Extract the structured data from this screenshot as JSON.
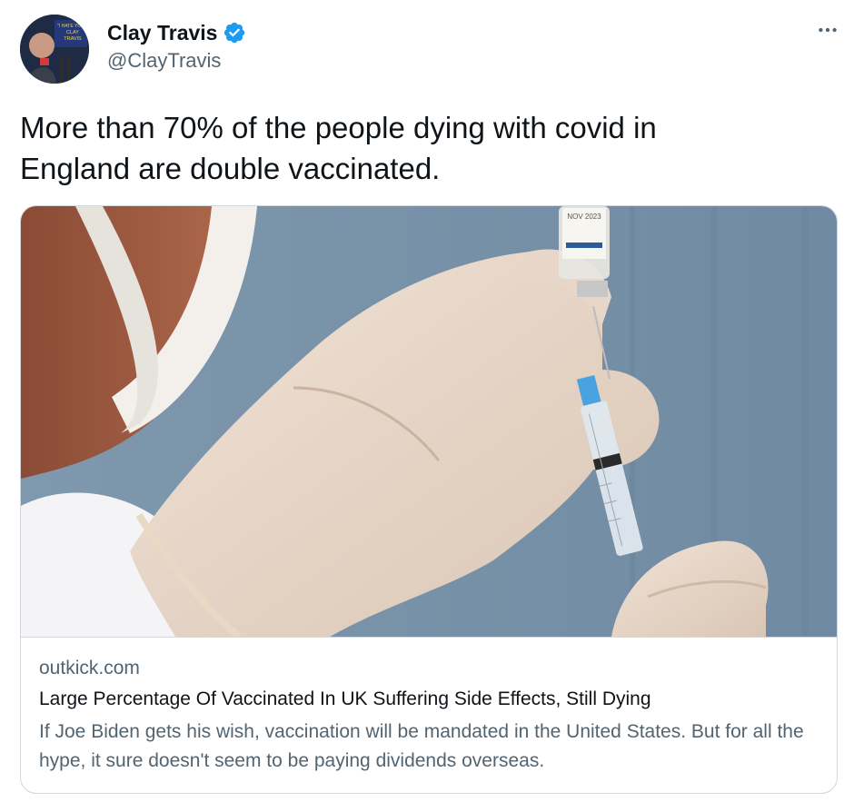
{
  "author": {
    "display_name": "Clay Travis",
    "handle": "@ClayTravis",
    "verified": true,
    "avatar_icon": "profile-photo-avatar",
    "avatar_sign_text": "I HATE YOU CLAY TRAVIS"
  },
  "tweet": {
    "text": "More than 70% of the people dying with covid in\nEngland are double vaccinated."
  },
  "card": {
    "media_icon": "vaccine-syringe-photo",
    "vial_label_text": "NOV 2023",
    "domain": "outkick.com",
    "title": "Large Percentage Of Vaccinated In UK Suffering Side Effects, Still Dying",
    "description": "If Joe Biden gets his wish, vaccination will be mandated in the United States. But for all the hype, it sure doesn't seem to be paying dividends overseas."
  },
  "icons": {
    "verified": "verified-badge-icon",
    "more": "more-options-icon"
  },
  "colors": {
    "text_primary": "#0f1419",
    "text_secondary": "#536471",
    "verified_blue": "#1d9bf0",
    "border": "#cfd9de"
  }
}
